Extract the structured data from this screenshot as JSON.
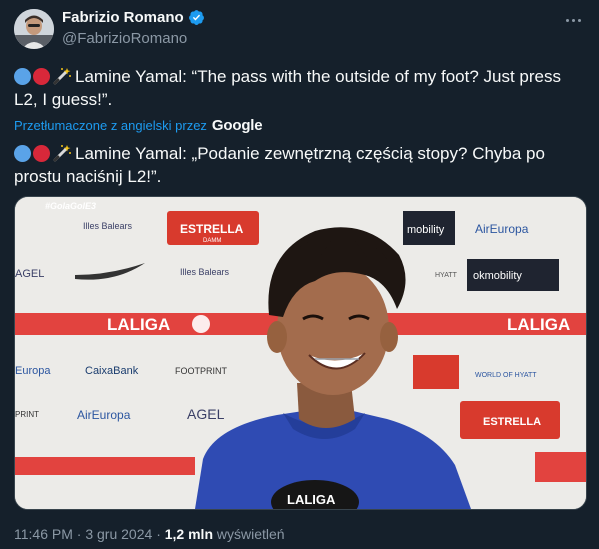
{
  "author": {
    "display_name": "Fabrizio Romano",
    "handle": "@FabrizioRomano",
    "avatar_icon": "avatar-photo",
    "verified": true
  },
  "tweet": {
    "line1_text": "Lamine Yamal: “The pass with the outside of my foot? Just press L2, I guess!”.",
    "translated_label": "Przetłumaczone z angielski przez",
    "translator_brand": "Google",
    "line2_text": "Lamine Yamal: „Podanie zewnętrzną częścią stopy? Chyba po prostu naciśnij L2!”."
  },
  "media": {
    "hashtag": "#GolaGolE3",
    "sponsors": {
      "estrella": "ESTRELLA",
      "damm": "DAMM",
      "airEuropa": "AirEuropa",
      "laliga": "LALIGA",
      "okmobility": "okmobility",
      "caixabank": "CaixaBank",
      "footprint": "FOOTPRINT",
      "hyatt": "HYATT",
      "world_of_hyatt": "WORLD OF HYATT",
      "illes_balears": "Illes Balears",
      "agel": "AGEL",
      "europa": "Europa",
      "print": "PRINT",
      "mobility": "mobility",
      "mic_label": "LALIGA"
    }
  },
  "meta": {
    "time": "11:46 PM",
    "separator": "·",
    "date": "3 gru 2024",
    "views_count": "1,2 mln",
    "views_label": "wyświetleń"
  },
  "colors": {
    "background": "#15202b",
    "text": "#f7f9f9",
    "secondary": "#8b98a5",
    "link": "#1d9bf0",
    "laliga_red": "#e2433f",
    "jersey_blue": "#2f4bb3"
  }
}
